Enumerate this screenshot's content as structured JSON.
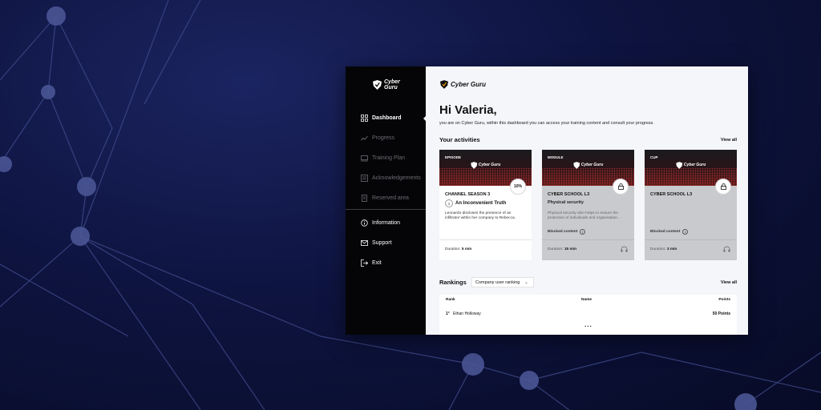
{
  "sidebar": {
    "logo_text": "Cyber Guru",
    "items": [
      {
        "label": "Dashboard",
        "icon": "dashboard-icon"
      },
      {
        "label": "Progress",
        "icon": "trend-icon"
      },
      {
        "label": "Training Plan",
        "icon": "training-plan-icon"
      },
      {
        "label": "Acknowledgements",
        "icon": "acknowledgements-icon"
      },
      {
        "label": "Reserved area",
        "icon": "reserved-area-icon"
      }
    ],
    "secondary": [
      {
        "label": "Information",
        "icon": "info-icon"
      },
      {
        "label": "Support",
        "icon": "mail-icon"
      },
      {
        "label": "Exit",
        "icon": "exit-icon"
      }
    ]
  },
  "main": {
    "brand": "Cyber Guru",
    "greeting": "Hi Valeria,",
    "subtitle": "you are on Cyber Guru, within this dashboard you can access your training content and consult your progress.",
    "activities": {
      "title": "Your activities",
      "view_all": "View all",
      "cards": [
        {
          "tag": "EPISODE",
          "progress": "10%",
          "title": "CHANNEL SEASON 3",
          "episode_num": "3",
          "episode_title": "An Inconvenient Truth",
          "desc": "Leonardo discloses the presence of an infiltrator within her company to Rebecca.",
          "duration_label": "Duration:",
          "duration": "5 min"
        },
        {
          "tag": "MODULE",
          "title": "CYBER SCHOOL L3",
          "subtitle": "Physical security",
          "desc": "Physical security also helps to ensure the protection of individuals and organisation...",
          "blocked": "Blocked content",
          "duration_label": "Duration:",
          "duration": "15 min"
        },
        {
          "tag": "CUP",
          "title": "CYBER SCHOOL L3",
          "blocked": "Blocked content",
          "duration_label": "Duration:",
          "duration": "3 min"
        }
      ]
    },
    "rankings": {
      "title": "Rankings",
      "select_value": "Company user ranking",
      "view_all": "View all",
      "columns": {
        "rank": "Rank",
        "name": "Name",
        "points": "Points"
      },
      "rows": [
        {
          "rank": "1°",
          "name": "Ethan Holloway",
          "points": "50 Points"
        }
      ],
      "more": "..."
    }
  }
}
